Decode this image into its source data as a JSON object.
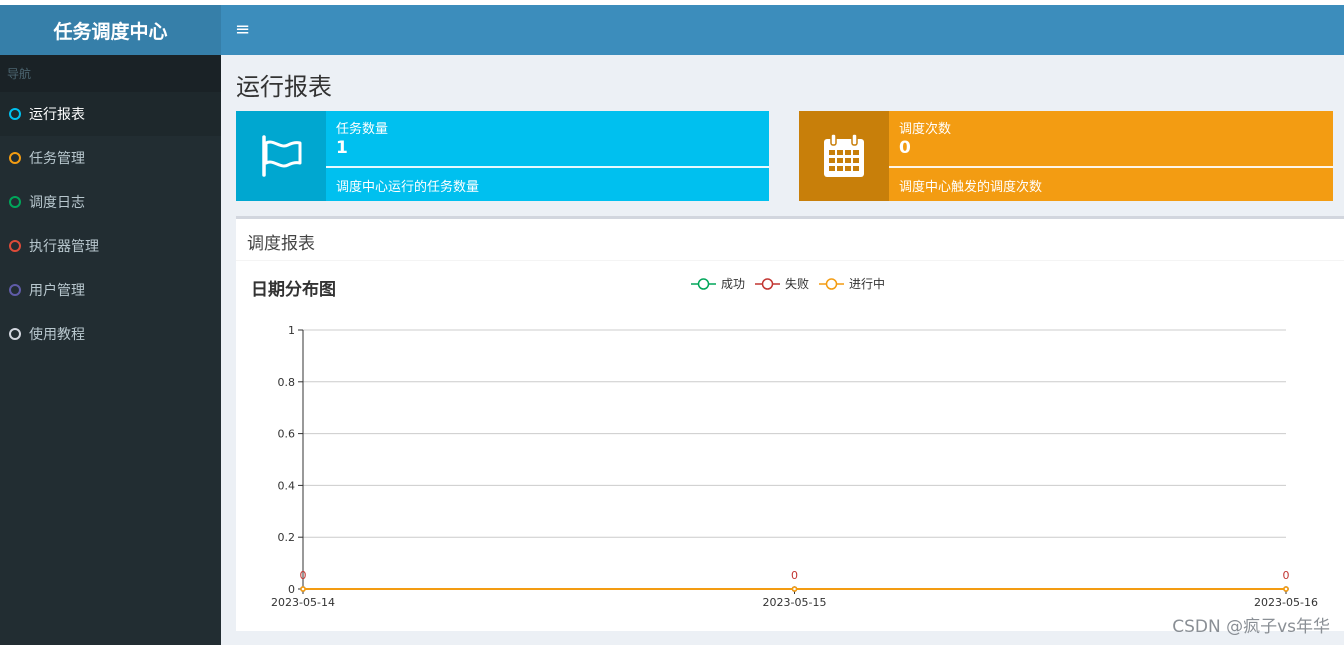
{
  "app": {
    "title": "任务调度中心",
    "hamburger": "≡"
  },
  "sidebar": {
    "header": "导航",
    "items": [
      {
        "label": "运行报表",
        "color": "#00c0ef",
        "active": true
      },
      {
        "label": "任务管理",
        "color": "#f39c12"
      },
      {
        "label": "调度日志",
        "color": "#00a65a"
      },
      {
        "label": "执行器管理",
        "color": "#dd4b39"
      },
      {
        "label": "用户管理",
        "color": "#605ca8"
      },
      {
        "label": "使用教程",
        "color": "#d2d6de"
      }
    ]
  },
  "page": {
    "title": "运行报表"
  },
  "infoboxes": [
    {
      "label": "任务数量",
      "value": "1",
      "desc": "调度中心运行的任务数量",
      "icon": "flag-icon",
      "color": "#00c0ef"
    },
    {
      "label": "调度次数",
      "value": "0",
      "desc": "调度中心触发的调度次数",
      "icon": "calendar-icon",
      "color": "#f39c12"
    }
  ],
  "panel": {
    "title": "调度报表"
  },
  "chart_data": {
    "type": "line",
    "title": "日期分布图",
    "categories": [
      "2023-05-14",
      "2023-05-15",
      "2023-05-16"
    ],
    "series": [
      {
        "name": "成功",
        "values": [
          0,
          0,
          0
        ],
        "color": "#00a65a"
      },
      {
        "name": "失败",
        "values": [
          0,
          0,
          0
        ],
        "color": "#c23531"
      },
      {
        "name": "进行中",
        "values": [
          0,
          0,
          0
        ],
        "color": "#f39c12"
      }
    ],
    "ylim": [
      0,
      1
    ],
    "yticks": [
      "0",
      "0.2",
      "0.4",
      "0.6",
      "0.8",
      "1"
    ],
    "grid": true,
    "legend": "top-center"
  },
  "watermark": "CSDN @疯子vs年华"
}
